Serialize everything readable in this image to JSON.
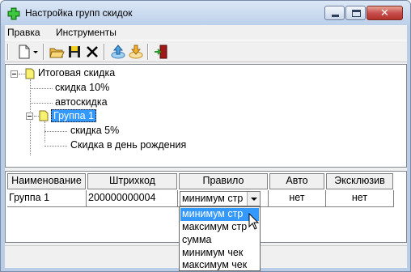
{
  "window": {
    "title": "Настройка групп скидок"
  },
  "menu": {
    "items": [
      "Правка",
      "Инструменты"
    ]
  },
  "toolbar": {
    "buttons": [
      "new-document-icon",
      "dropdown-arrow-icon",
      "open-folder-icon",
      "save-disk-icon",
      "delete-x-icon",
      "move-up-icon",
      "move-down-icon",
      "exit-door-icon"
    ]
  },
  "tree": {
    "root": "Итоговая скидка",
    "children": [
      "скидка 10%",
      "автоскидка"
    ],
    "group": "Группа 1",
    "group_children": [
      "скидка 5%",
      "Скидка в день рождения"
    ]
  },
  "grid": {
    "columns": [
      "Наименование",
      "Штрихкод",
      "Правило",
      "Авто",
      "Эксклюзив"
    ],
    "row": {
      "name": "Группа 1",
      "barcode": "200000000004",
      "rule": "минимум стр",
      "auto": "нет",
      "exclusive": "нет"
    }
  },
  "dropdown": {
    "options": [
      "минимум стр",
      "максимум стр",
      "сумма",
      "минимум чек",
      "максимум чек"
    ],
    "selected": "минимум стр"
  },
  "colors": {
    "selection": "#3399ff",
    "close_button": "#c75050"
  }
}
